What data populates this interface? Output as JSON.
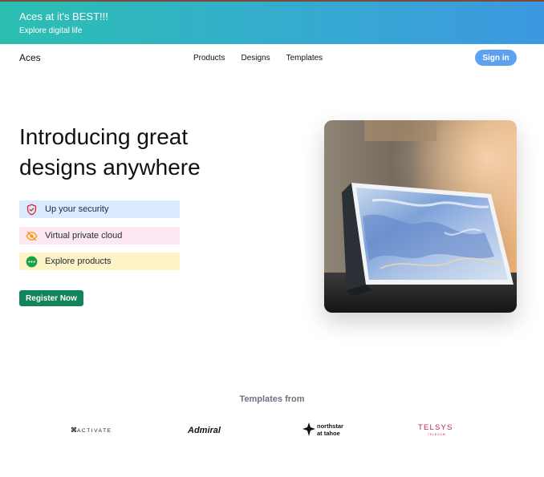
{
  "banner": {
    "title": "Aces at it's BEST!!!",
    "subtitle": "Explore digital life"
  },
  "navbar": {
    "brand": "Aces",
    "links": [
      "Products",
      "Designs",
      "Templates"
    ],
    "signin_label": "Sign in"
  },
  "hero": {
    "title": "Introducing great designs anywhere",
    "features": [
      {
        "label": "Up your security",
        "icon": "shield-icon",
        "color": "#dbeafe"
      },
      {
        "label": "Virtual private cloud",
        "icon": "eye-off-icon",
        "color": "#fce7f3"
      },
      {
        "label": "Explore products",
        "icon": "more-dots-icon",
        "color": "#fef3c7"
      }
    ],
    "register_label": "Register Now",
    "image": "laptop-photo"
  },
  "templates": {
    "heading": "Templates from",
    "logos": [
      {
        "name": "ACTIVATE"
      },
      {
        "name": "Admiral"
      },
      {
        "name": "northstar",
        "sub": "at tahoe"
      },
      {
        "name": "TELSYS",
        "sub": "TELECOM"
      }
    ]
  },
  "colors": {
    "banner_start": "#2bbfb0",
    "banner_end": "#3d98e0",
    "signin": "#5ea2ef",
    "register": "#13835a"
  }
}
